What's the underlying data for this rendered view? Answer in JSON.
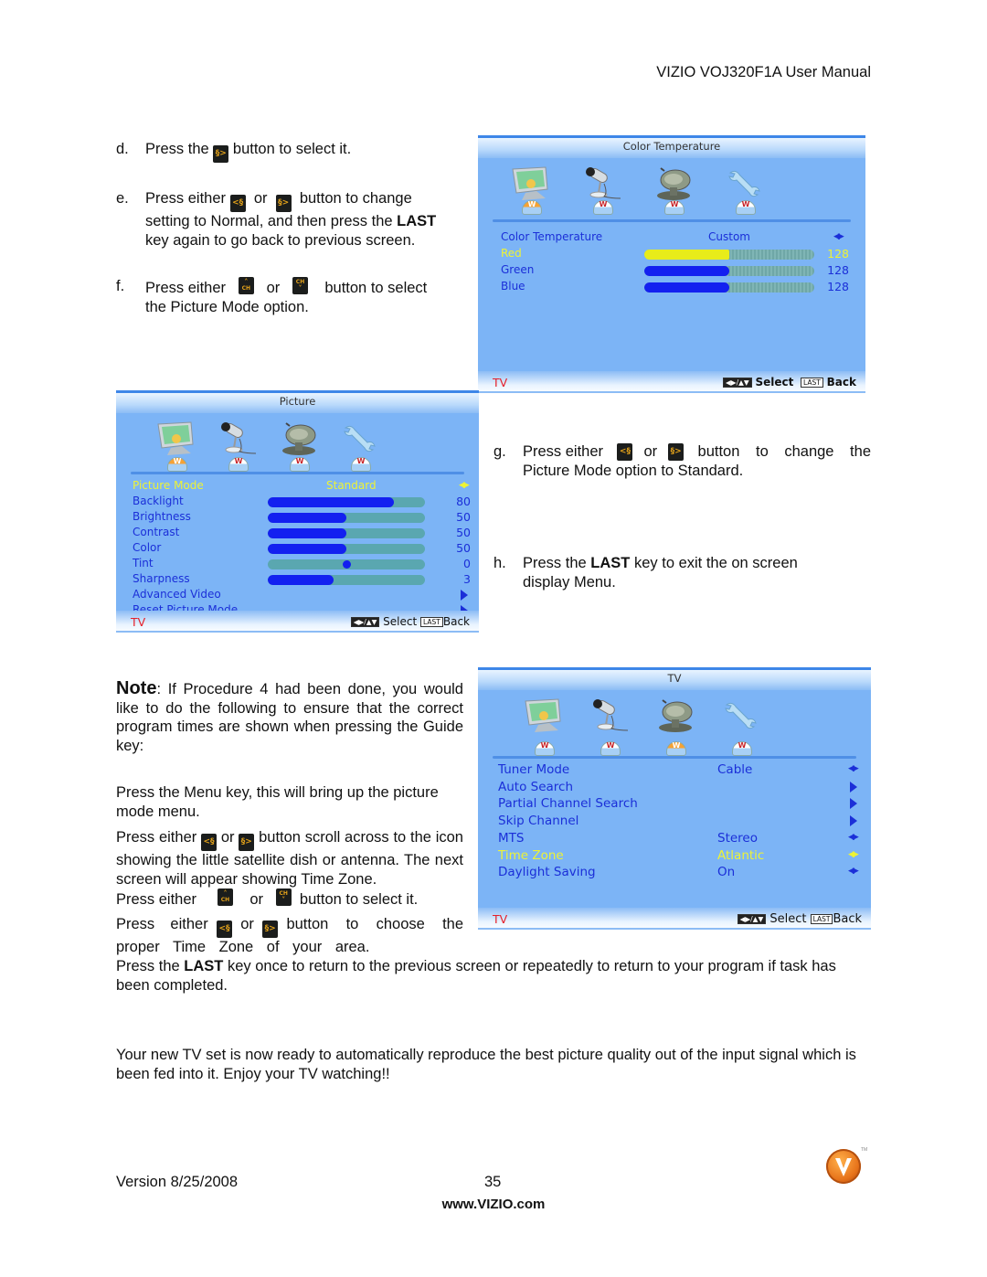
{
  "header": {
    "title": "VIZIO VOJ320F1A User Manual"
  },
  "steps_top": [
    {
      "letter": "d.",
      "parts": [
        "Press the",
        "button to select it."
      ],
      "keys": [
        "right-key"
      ]
    },
    {
      "letter": "e.",
      "line1": [
        "Press either",
        "or",
        "button to change"
      ],
      "line2_pre": "setting to Normal, and then press the ",
      "line2_bold": "LAST",
      "line3": "key again to go back to previous screen.",
      "keys": [
        "left-key",
        "right-key"
      ]
    },
    {
      "letter": "f.",
      "line1": [
        "Press either",
        "or",
        "button to select"
      ],
      "line2": "the Picture Mode option.",
      "keys": [
        "ch-up-key",
        "ch-down-key"
      ]
    }
  ],
  "steps_right": [
    {
      "letter": "g.",
      "line1": [
        "Press either",
        "or",
        "button to change the"
      ],
      "line2": "Picture Mode option to Standard.",
      "keys": [
        "left-key",
        "right-key"
      ]
    },
    {
      "letter": "h.",
      "line1_pre": "Press the ",
      "line1_bold": "LAST",
      "line1_post": " key to exit the on screen",
      "line2": "display Menu."
    }
  ],
  "keys": {
    "left_glyph": "<§",
    "right_glyph": "§>",
    "ch": "CH",
    "up": "˄",
    "down": "˅"
  },
  "color_temperature_menu": {
    "title": "Color Temperature",
    "active_tab": 0,
    "rows": [
      {
        "label": "Color Temperature",
        "value": "Custom",
        "control": "left-right"
      },
      {
        "label": "Red",
        "value": 128,
        "fraction": 0.5,
        "highlighted": true
      },
      {
        "label": "Green",
        "value": 128,
        "fraction": 0.5
      },
      {
        "label": "Blue",
        "value": 128,
        "fraction": 0.5
      }
    ],
    "footer": {
      "source": "TV",
      "nav_key": "◀▶/▲▼",
      "select": "Select",
      "last_key": "LAST",
      "back": "Back"
    }
  },
  "picture_menu": {
    "title": "Picture",
    "active_tab": 0,
    "rows": [
      {
        "label": "Picture Mode",
        "value": "Standard",
        "control": "left-right",
        "highlighted": true
      },
      {
        "label": "Backlight",
        "value": 80,
        "fraction": 0.8
      },
      {
        "label": "Brightness",
        "value": 50,
        "fraction": 0.5
      },
      {
        "label": "Contrast",
        "value": 50,
        "fraction": 0.5
      },
      {
        "label": "Color",
        "value": 50,
        "fraction": 0.5
      },
      {
        "label": "Tint",
        "value": 0,
        "fraction": 0.5,
        "control": "knob"
      },
      {
        "label": "Sharpness",
        "value": 3,
        "fraction": 0.42
      },
      {
        "label": "Advanced Video",
        "control": "submenu"
      },
      {
        "label": "Reset Picture Mode",
        "control": "submenu"
      }
    ],
    "footer": {
      "source": "TV",
      "nav_key": "◀▶/▲▼",
      "select": "Select",
      "last_key": "LAST",
      "back": "Back"
    }
  },
  "tv_menu": {
    "title": "TV",
    "active_tab": 2,
    "rows": [
      {
        "label": "Tuner Mode",
        "value": "Cable",
        "control": "left-right"
      },
      {
        "label": "Auto Search",
        "control": "submenu"
      },
      {
        "label": "Partial Channel Search",
        "control": "submenu"
      },
      {
        "label": "Skip Channel",
        "control": "submenu"
      },
      {
        "label": "MTS",
        "value": "Stereo",
        "control": "left-right"
      },
      {
        "label": "Time Zone",
        "value": "Atlantic",
        "control": "left-right",
        "highlighted": true
      },
      {
        "label": "Daylight Saving",
        "value": "On",
        "control": "left-right"
      }
    ],
    "footer": {
      "source": "TV",
      "nav_key": "◀▶/▲▼",
      "select": "Select",
      "last_key": "LAST",
      "back": "Back"
    }
  },
  "menu_tabs": [
    "picture-icon",
    "audio-microphone-icon",
    "tv-satellite-dish-icon",
    "setup-wrench-icon"
  ],
  "note": {
    "label": "Note",
    "text": ": If Procedure 4 had been done, you would like to do the following to ensure that the correct program times are shown when pressing the Guide key:",
    "p1": "Press the Menu key, this will bring up the picture mode menu.",
    "p2_a": "Press either",
    "p2_or": "or",
    "p2_b": "button scroll across to the icon showing the little satellite dish or antenna. The next screen will appear showing Time Zone.",
    "p3_a": "Press either",
    "p3_or": "or",
    "p3_b": "button to select it.",
    "p4_a": "Press either",
    "p4_or": "or",
    "p4_b": "button to choose the proper Time Zone of your area."
  },
  "bottom": {
    "p1_pre": "Press the ",
    "p1_bold": "LAST",
    "p1_post": " key once to return to the previous screen or repeatedly to return to your program if task has been completed.",
    "p2": "Your new TV set is now ready to automatically reproduce the best picture quality out of the input signal which is been fed into it. Enjoy your TV watching!!"
  },
  "footer": {
    "version": "Version 8/25/2008",
    "page_number": "35",
    "website": "www.VIZIO.com",
    "logo_letter": "V",
    "logo_tm": "TM"
  },
  "colors": {
    "osd_bg": "#7cb4f6",
    "osd_text": "#1b2fd8",
    "osd_highlight": "#eef335",
    "bar_fill": "#1320f0",
    "bar_track": "#5aa7b0",
    "tv_label": "#e5202a",
    "logo": "#e7731a"
  }
}
